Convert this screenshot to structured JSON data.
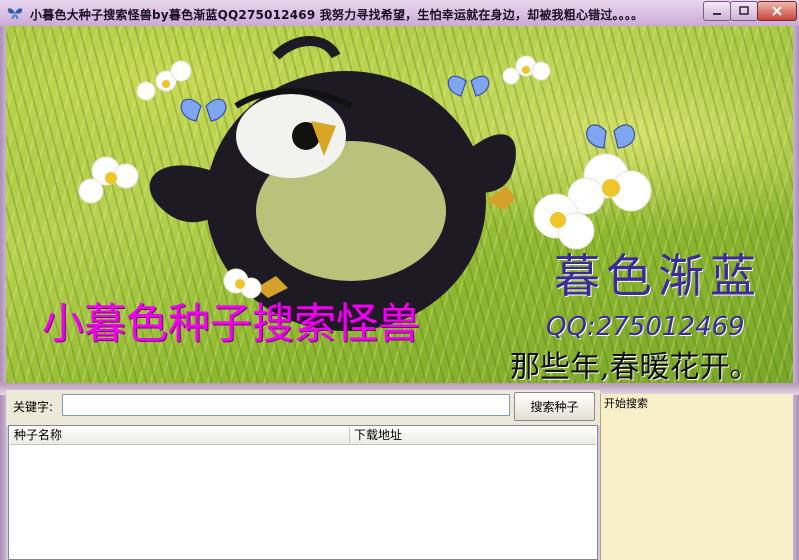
{
  "window": {
    "title": "小暮色大种子搜索怪兽by暮色渐蓝QQ275012469    我努力寻找希望，生怕幸运就在身边，却被我粗心错过。。。。",
    "icon": "butterfly-icon"
  },
  "banner": {
    "caption": "小暮色种子搜索怪兽",
    "signature_name": "暮色渐蓝",
    "signature_qq": "QQ:275012469",
    "signature_poem": "那些年,春暖花开。"
  },
  "search": {
    "label": "关键字:",
    "value": "",
    "button_label": "搜索种子"
  },
  "results_table": {
    "columns": [
      "种子名称",
      "下载地址"
    ],
    "rows": []
  },
  "status_panel": {
    "text": "开始搜索"
  },
  "colors": {
    "caption": "#f000f0",
    "signature": "#3a2a9a",
    "status_bg": "#f7efc7",
    "titlebar": "#d9bfe2"
  }
}
